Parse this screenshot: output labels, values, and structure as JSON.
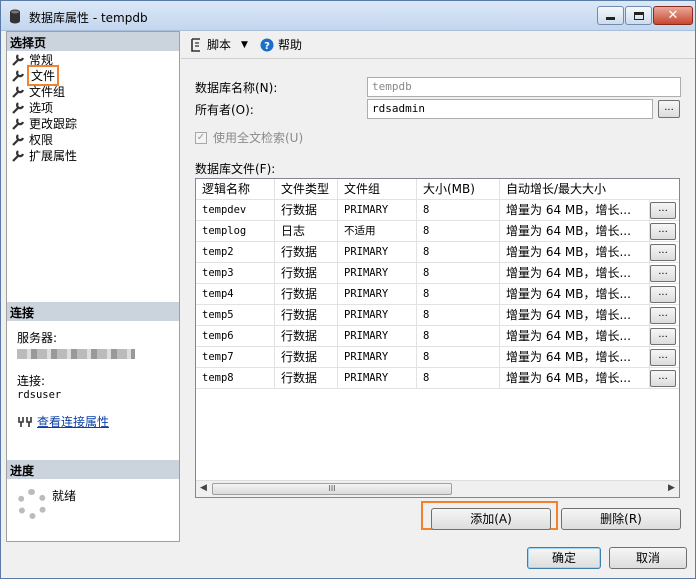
{
  "window": {
    "title": "数据库属性 - tempdb"
  },
  "left": {
    "select_page_header": "选择页",
    "nav_items": [
      {
        "label": "常规"
      },
      {
        "label": "文件"
      },
      {
        "label": "文件组"
      },
      {
        "label": "选项"
      },
      {
        "label": "更改跟踪"
      },
      {
        "label": "权限"
      },
      {
        "label": "扩展属性"
      }
    ],
    "connection_header": "连接",
    "server_label": "服务器:",
    "connection_label": "连接:",
    "connection_value": "rdsuser",
    "view_conn_props_link": "查看连接属性",
    "progress_header": "进度",
    "progress_status": "就绪"
  },
  "toolbar": {
    "script_label": "脚本",
    "help_label": "帮助"
  },
  "form": {
    "db_name_label": "数据库名称(N):",
    "db_name_value": "tempdb",
    "owner_label": "所有者(O):",
    "owner_value": "rdsadmin",
    "fulltext_label": "使用全文检索(U)",
    "db_files_label": "数据库文件(F):"
  },
  "grid": {
    "columns": [
      "逻辑名称",
      "文件类型",
      "文件组",
      "大小(MB)",
      "自动增长/最大大小"
    ],
    "rows": [
      {
        "name": "tempdev",
        "type": "行数据",
        "group": "PRIMARY",
        "size": "8",
        "growth": "增量为 64 MB，增长..."
      },
      {
        "name": "templog",
        "type": "日志",
        "group": "不适用",
        "size": "8",
        "growth": "增量为 64 MB，增长..."
      },
      {
        "name": "temp2",
        "type": "行数据",
        "group": "PRIMARY",
        "size": "8",
        "growth": "增量为 64 MB，增长..."
      },
      {
        "name": "temp3",
        "type": "行数据",
        "group": "PRIMARY",
        "size": "8",
        "growth": "增量为 64 MB，增长..."
      },
      {
        "name": "temp4",
        "type": "行数据",
        "group": "PRIMARY",
        "size": "8",
        "growth": "增量为 64 MB，增长..."
      },
      {
        "name": "temp5",
        "type": "行数据",
        "group": "PRIMARY",
        "size": "8",
        "growth": "增量为 64 MB，增长..."
      },
      {
        "name": "temp6",
        "type": "行数据",
        "group": "PRIMARY",
        "size": "8",
        "growth": "增量为 64 MB，增长..."
      },
      {
        "name": "temp7",
        "type": "行数据",
        "group": "PRIMARY",
        "size": "8",
        "growth": "增量为 64 MB，增长..."
      },
      {
        "name": "temp8",
        "type": "行数据",
        "group": "PRIMARY",
        "size": "8",
        "growth": "增量为 64 MB，增长..."
      }
    ],
    "ellipsis": "...",
    "scroll_thumb_glyph": "III"
  },
  "buttons": {
    "add": "添加(A)",
    "remove": "删除(R)",
    "ok": "确定",
    "cancel": "取消"
  },
  "colors": {
    "highlight": "#f5812d",
    "link": "#0b3fa6"
  }
}
